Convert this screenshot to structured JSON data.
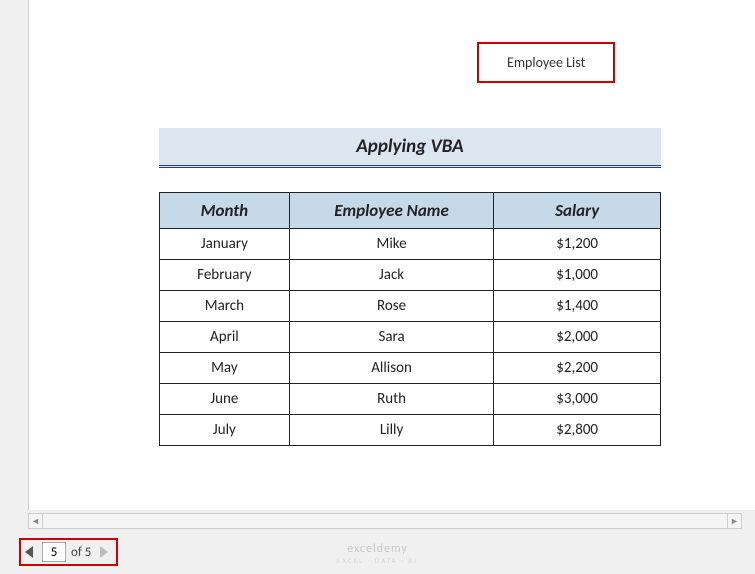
{
  "header": {
    "label": "Employee List"
  },
  "title": "Applying VBA",
  "table": {
    "headers": [
      "Month",
      "Employee Name",
      "Salary"
    ],
    "rows": [
      [
        "January",
        "Mike",
        "$1,200"
      ],
      [
        "February",
        "Jack",
        "$1,000"
      ],
      [
        "March",
        "Rose",
        "$1,400"
      ],
      [
        "April",
        "Sara",
        "$2,000"
      ],
      [
        "May",
        "Allison",
        "$2,200"
      ],
      [
        "June",
        "Ruth",
        "$3,000"
      ],
      [
        "July",
        "Lilly",
        "$2,800"
      ]
    ]
  },
  "pagination": {
    "current": "5",
    "total_label": "of 5"
  },
  "watermark": {
    "main": "exceldemy",
    "sub": "EXCEL · DATA · BI"
  }
}
